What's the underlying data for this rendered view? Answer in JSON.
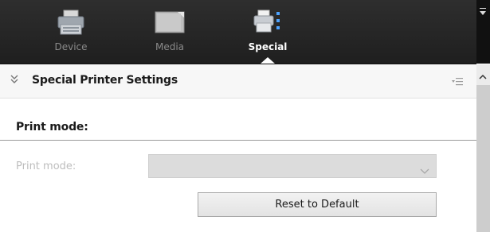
{
  "toolbar": {
    "tabs": [
      {
        "label": "Device",
        "icon": "printer-icon"
      },
      {
        "label": "Media",
        "icon": "media-icon"
      },
      {
        "label": "Special",
        "icon": "special-settings-icon",
        "active": true
      }
    ]
  },
  "section": {
    "title": "Special Printer Settings"
  },
  "print_mode_group": {
    "title": "Print mode:",
    "field_label": "Print mode:",
    "field_value": "",
    "reset_label": "Reset to Default"
  },
  "colors": {
    "toolbar_bg": "#262626",
    "active_label": "#ffffff",
    "inactive_label": "#8a8a8a",
    "disabled_text": "#bdbdbd"
  }
}
